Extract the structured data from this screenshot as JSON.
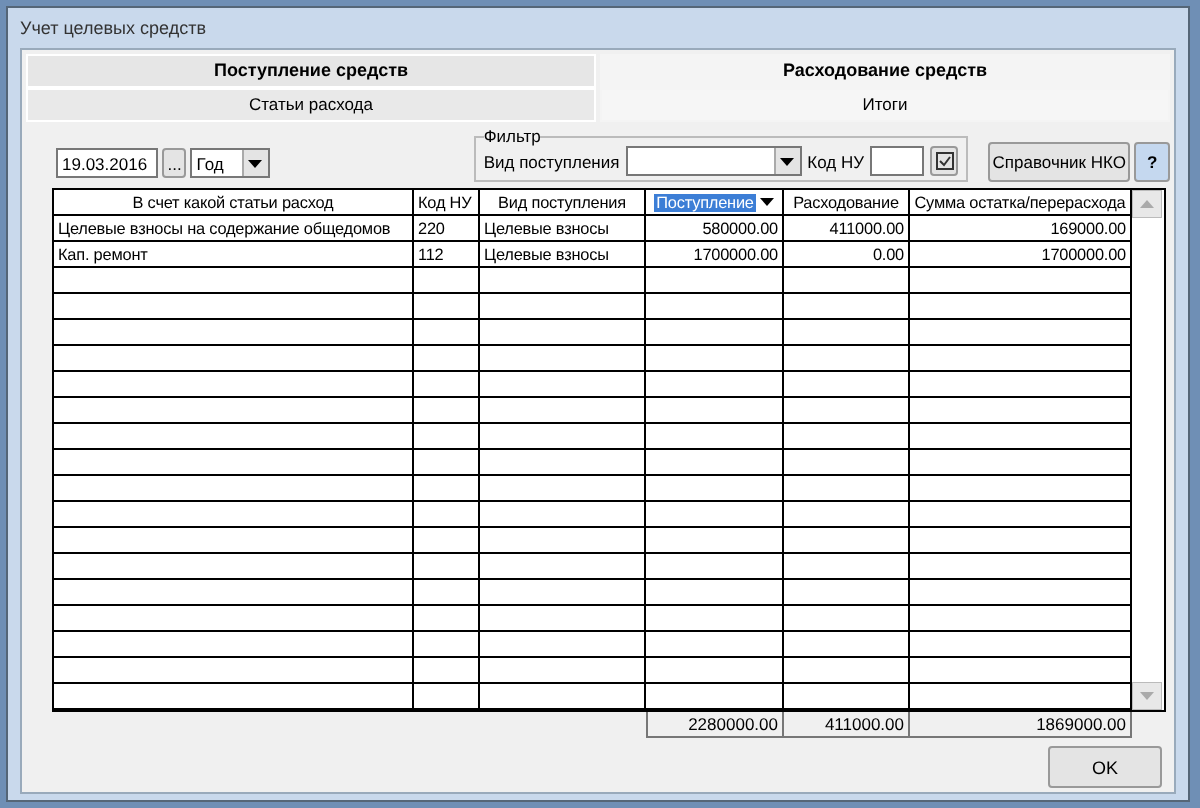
{
  "window": {
    "title": "Учет целевых средств"
  },
  "tabs": [
    {
      "label": "Поступление средств",
      "selected": false
    },
    {
      "label": "Расходование средств",
      "selected": true
    }
  ],
  "subtabs": [
    {
      "label": "Статьи расхода",
      "selected": false
    },
    {
      "label": "Итоги",
      "selected": true
    }
  ],
  "toolbar": {
    "date": "19.03.2016",
    "browse": "...",
    "period": "Год",
    "filter_title": "Фильтр",
    "income_type_label": "Вид поступления",
    "code_label": "Код НУ",
    "reference_button": "Справочник НКО",
    "help_button": "?"
  },
  "table": {
    "columns": [
      {
        "label": "В счет какой статьи расход",
        "sorted": false
      },
      {
        "label": "Код НУ",
        "sorted": false
      },
      {
        "label": "Вид поступления",
        "sorted": false
      },
      {
        "label": "Поступление",
        "sorted": true
      },
      {
        "label": "Расходование",
        "sorted": false
      },
      {
        "label": "Сумма остатка/перерасхода",
        "sorted": false
      }
    ],
    "rows": [
      [
        "Целевые взносы на содержание общедомов",
        "220",
        "Целевые взносы",
        "580000.00",
        "411000.00",
        "169000.00"
      ],
      [
        "Кап. ремонт",
        "112",
        "Целевые взносы",
        "1700000.00",
        "0.00",
        "1700000.00"
      ]
    ],
    "totals": [
      "2280000.00",
      "411000.00",
      "1869000.00"
    ]
  },
  "buttons": [
    "OK"
  ]
}
